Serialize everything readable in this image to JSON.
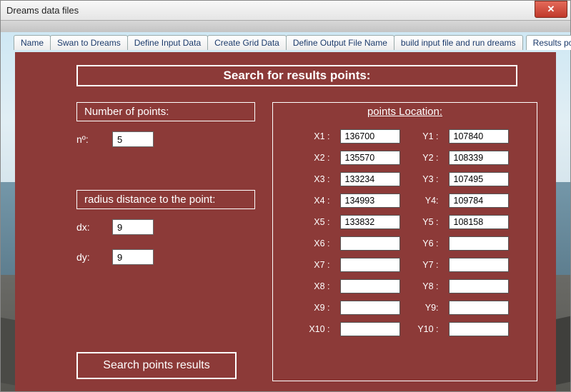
{
  "window": {
    "title": "Dreams data files"
  },
  "tabs": [
    "Name",
    "Swan to Dreams",
    "Define Input Data",
    "Create Grid Data",
    "Define Output File Name",
    "build input file and run dreams",
    "Results points"
  ],
  "active_tab": "Results points",
  "section_title": "Search for results points:",
  "left": {
    "number_title": "Number of points:",
    "n_label": "nº:",
    "n_value": "5",
    "radius_title": "radius distance to the point:",
    "dx_label": "dx:",
    "dx_value": "9",
    "dy_label": "dy:",
    "dy_value": "9"
  },
  "search_button": "Search points results",
  "right": {
    "title": "points Location:",
    "rows": [
      {
        "xl": "X1 :",
        "x": "136700",
        "yl": "Y1 :",
        "y": "107840"
      },
      {
        "xl": "X2 :",
        "x": "135570",
        "yl": "Y2 :",
        "y": "108339"
      },
      {
        "xl": "X3 :",
        "x": "133234",
        "yl": "Y3 :",
        "y": "107495"
      },
      {
        "xl": "X4 :",
        "x": "134993",
        "yl": "Y4:",
        "y": "109784"
      },
      {
        "xl": "X5 :",
        "x": "133832",
        "yl": "Y5 :",
        "y": "108158"
      },
      {
        "xl": "X6 :",
        "x": "",
        "yl": "Y6 :",
        "y": ""
      },
      {
        "xl": "X7 :",
        "x": "",
        "yl": "Y7 :",
        "y": ""
      },
      {
        "xl": "X8 :",
        "x": "",
        "yl": "Y8 :",
        "y": ""
      },
      {
        "xl": "X9 :",
        "x": "",
        "yl": "Y9:",
        "y": ""
      },
      {
        "xl": "X10 :",
        "x": "",
        "yl": "Y10 :",
        "y": ""
      }
    ]
  }
}
